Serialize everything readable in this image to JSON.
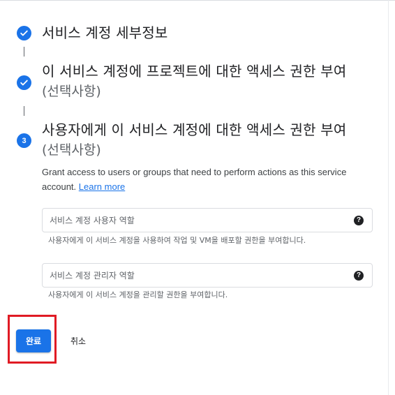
{
  "steps": [
    {
      "status": "complete",
      "icon": "check-icon",
      "title": "서비스 계정 세부정보"
    },
    {
      "status": "complete",
      "icon": "check-icon",
      "title": "이 서비스 계정에 프로젝트에 대한 액세스 권한 부여",
      "subtitle": "(선택사항)"
    },
    {
      "status": "active",
      "number": "3",
      "title": "사용자에게 이 서비스 계정에 대한 액세스 권한 부여",
      "subtitle": "(선택사항)"
    }
  ],
  "description": {
    "text": "Grant access to users or groups that need to perform actions as this service account.",
    "link": "Learn more"
  },
  "fields": [
    {
      "placeholder": "서비스 계정 사용자 역할",
      "value": "",
      "help_icon": "help-icon",
      "hint": "사용자에게 이 서비스 계정을 사용하여 작업 및 VM을 배포할 권한을 부여합니다."
    },
    {
      "placeholder": "서비스 계정 관리자 역할",
      "value": "",
      "help_icon": "help-icon",
      "hint": "사용자에게 이 서비스 계정을 관리할 권한을 부여합니다."
    }
  ],
  "actions": {
    "done_label": "완료",
    "cancel_label": "취소"
  },
  "colors": {
    "accent": "#1a73e8",
    "highlight": "#e01b24",
    "text": "#202124",
    "muted": "#5f6368",
    "border": "#dadce0"
  }
}
